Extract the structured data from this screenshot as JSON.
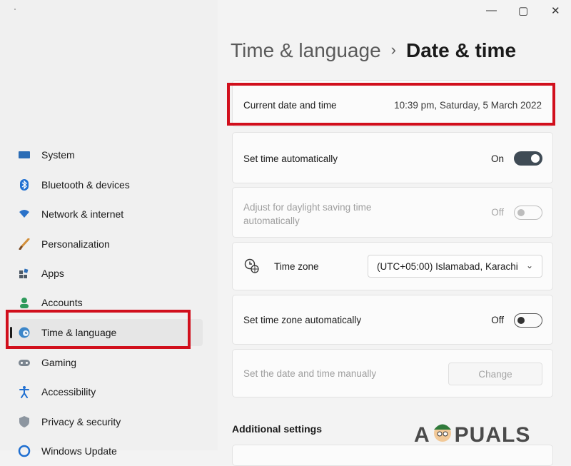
{
  "window": {
    "minimize": "—",
    "maximize": "▢",
    "close": "✕"
  },
  "sidebar": {
    "items": [
      {
        "label": "System"
      },
      {
        "label": "Bluetooth & devices"
      },
      {
        "label": "Network & internet"
      },
      {
        "label": "Personalization"
      },
      {
        "label": "Apps"
      },
      {
        "label": "Accounts"
      },
      {
        "label": "Time & language"
      },
      {
        "label": "Gaming"
      },
      {
        "label": "Accessibility"
      },
      {
        "label": "Privacy & security"
      },
      {
        "label": "Windows Update"
      }
    ]
  },
  "header": {
    "parent": "Time & language",
    "separator": "›",
    "title": "Date & time"
  },
  "current": {
    "label": "Current date and time",
    "value": "10:39 pm, Saturday, 5 March 2022"
  },
  "set_auto": {
    "label": "Set time automatically",
    "state": "On"
  },
  "daylight": {
    "label": "Adjust for daylight saving time automatically",
    "state": "Off"
  },
  "timezone": {
    "label": "Time zone",
    "value": "(UTC+05:00) Islamabad, Karachi",
    "chevron": "⌄"
  },
  "tz_auto": {
    "label": "Set time zone automatically",
    "state": "Off"
  },
  "manual": {
    "label": "Set the date and time manually",
    "button": "Change"
  },
  "additional": {
    "title": "Additional settings"
  },
  "watermark": {
    "text_a": "A",
    "text_b": "PUALS"
  },
  "colors": {
    "highlight": "#d10f1c",
    "toggle_on": "#3f4b55"
  }
}
